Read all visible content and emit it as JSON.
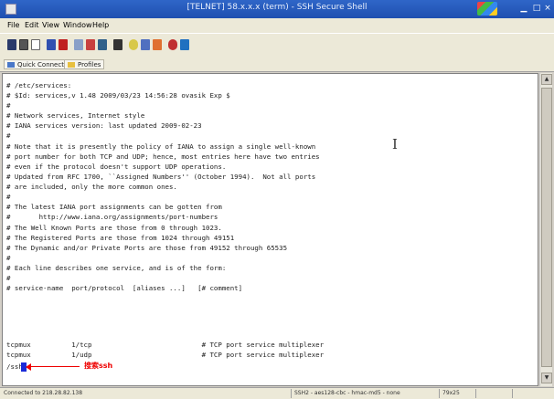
{
  "window": {
    "title": "[TELNET] 58.x.x.x (term) - SSH Secure Shell",
    "menus": [
      "File",
      "Edit",
      "View",
      "Window",
      "Help"
    ]
  },
  "quickbar": {
    "quick_connect": "Quick Connect",
    "profiles": "Profiles"
  },
  "terminal": {
    "lines": [
      "# /etc/services:",
      "# $Id: services,v 1.48 2009/03/23 14:56:28 ovasik Exp $",
      "#",
      "# Network services, Internet style",
      "# IANA services version: last updated 2009-02-23",
      "#",
      "# Note that it is presently the policy of IANA to assign a single well-known",
      "# port number for both TCP and UDP; hence, most entries here have two entries",
      "# even if the protocol doesn't support UDP operations.",
      "# Updated from RFC 1700, ``Assigned Numbers'' (October 1994).  Not all ports",
      "# are included, only the more common ones.",
      "#",
      "# The latest IANA port assignments can be gotten from",
      "#       http://www.iana.org/assignments/port-numbers",
      "# The Well Known Ports are those from 0 through 1023.",
      "# The Registered Ports are those from 1024 through 49151",
      "# The Dynamic and/or Private Ports are those from 49152 through 65535",
      "#",
      "# Each line describes one service, and is of the form:",
      "#",
      "# service-name  port/protocol  [aliases ...]   [# comment]",
      "",
      "tcpmux          1/tcp                           # TCP port service multiplexer",
      "tcpmux          1/udp                           # TCP port service multiplexer"
    ],
    "prompt": "/ssh",
    "annotation": "搜索ssh"
  },
  "status": {
    "connection": "Connected to 218.28.82.138",
    "session": "SSH2 - aes128-cbc - hmac-md5 - none",
    "size": "79x25"
  },
  "colors": {
    "titlebar": "#2456b8",
    "annotation": "#e00000",
    "cursor": "#1a2ad8"
  }
}
